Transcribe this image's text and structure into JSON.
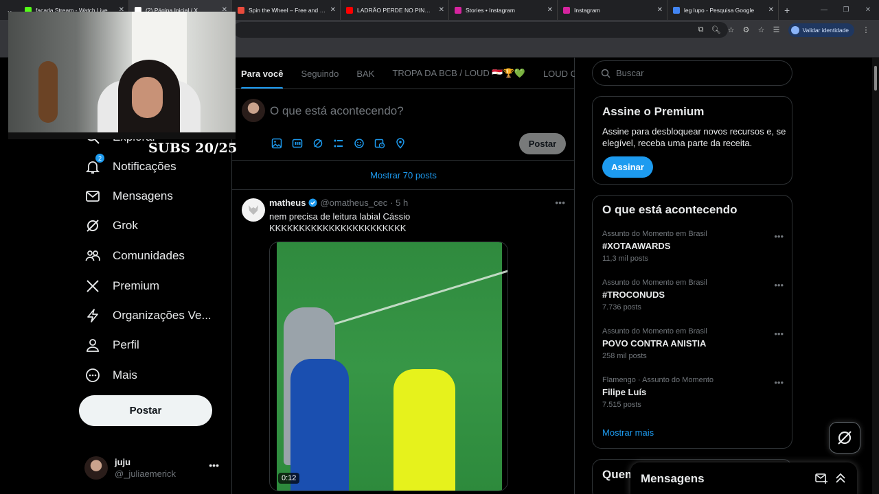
{
  "browser": {
    "tabs": [
      {
        "label": "facada Stream - Watch Live on",
        "favicon": "#53fc18"
      },
      {
        "label": "(2) Página Inicial / X",
        "favicon": "#ffffff",
        "active": true
      },
      {
        "label": "Spin the Wheel – Free and easy",
        "favicon": "#e94b3c"
      },
      {
        "label": "LADRÃO PERDE NO PINOTE E",
        "favicon": "#ff0000"
      },
      {
        "label": "Stories • Instagram",
        "favicon": "#d6249f"
      },
      {
        "label": "Instagram",
        "favicon": "#d6249f"
      },
      {
        "label": "leg lupo - Pesquisa Google",
        "favicon": "#4285f4"
      }
    ],
    "validar_label": "Validar identidade"
  },
  "overlay": {
    "subs_text": "SUBS 20/25"
  },
  "nav": {
    "items": [
      {
        "label": "Explorar",
        "icon": "search-icon"
      },
      {
        "label": "Notificações",
        "icon": "bell-icon",
        "badge": "2"
      },
      {
        "label": "Mensagens",
        "icon": "envelope-icon"
      },
      {
        "label": "Grok",
        "icon": "grok-icon"
      },
      {
        "label": "Comunidades",
        "icon": "communities-icon"
      },
      {
        "label": "Premium",
        "icon": "x-logo-icon"
      },
      {
        "label": "Organizações Ve...",
        "icon": "lightning-icon"
      },
      {
        "label": "Perfil",
        "icon": "person-icon"
      },
      {
        "label": "Mais",
        "icon": "more-circle-icon"
      }
    ],
    "post_label": "Postar",
    "account": {
      "name": "juju",
      "handle": "@_juliaemerick"
    }
  },
  "main": {
    "tabs": [
      "Para você",
      "Seguindo",
      "BAK",
      "TROPA DA BCB / LOUD 🇪🇬🏆💚",
      "LOUD Co"
    ],
    "compose_placeholder": "O que está acontecendo?",
    "compose_post_label": "Postar",
    "show_posts": "Mostrar 70 posts",
    "tweet": {
      "name": "matheus",
      "handle": "@omatheus_cec",
      "time": "· 5 h",
      "text_line1": "nem precisa de leitura labial Cássio",
      "text_line2": "KKKKKKKKKKKKKKKKKKKKKKK",
      "video_duration": "0:12"
    }
  },
  "right": {
    "search_placeholder": "Buscar",
    "premium": {
      "title": "Assine o Premium",
      "desc": "Assine para desbloquear novos recursos e, se elegível, receba uma parte da receita.",
      "button": "Assinar"
    },
    "trends": {
      "title": "O que está acontecendo",
      "items": [
        {
          "context": "Assunto do Momento em Brasil",
          "name": "#XOTAAWARDS",
          "count": "11,3 mil posts"
        },
        {
          "context": "Assunto do Momento em Brasil",
          "name": "#TROCONUDS",
          "count": "7.736 posts"
        },
        {
          "context": "Assunto do Momento em Brasil",
          "name": "POVO CONTRA ANISTIA",
          "count": "258 mil posts"
        },
        {
          "context": "Flamengo · Assunto do Momento",
          "name": "Filipe Luís",
          "count": "7.515 posts"
        }
      ],
      "show_more": "Mostrar mais"
    },
    "who_title": "Quem"
  },
  "messages_drawer": {
    "title": "Mensagens"
  }
}
